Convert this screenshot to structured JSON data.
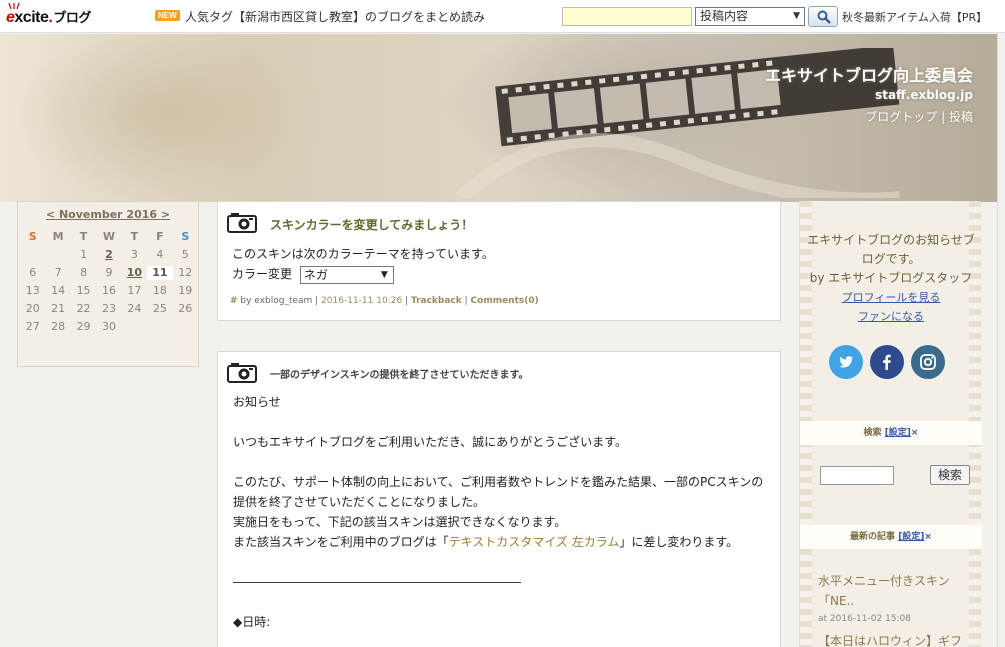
{
  "topbar": {
    "logo_e": "e",
    "logo_rest": "xcite",
    "logo_blog": "ブログ",
    "new_badge": "NEW",
    "tag_text": "人気タグ【新潟市西区貸し教室】のブログをまとめ読み",
    "search_value": "",
    "search_scope": "投稿内容",
    "pr_text": "秋冬最新アイテム入荷【PR】"
  },
  "header": {
    "title": "エキサイトブログ向上委員会",
    "domain": "staff.exblog.jp",
    "nav_top": "ブログトップ",
    "nav_sep": " | ",
    "nav_post": "投稿"
  },
  "calendar": {
    "title": "< November 2016 >",
    "dow": [
      "S",
      "M",
      "T",
      "W",
      "T",
      "F",
      "S"
    ],
    "days": [
      "",
      "",
      "1",
      "2",
      "3",
      "4",
      "5",
      "6",
      "7",
      "8",
      "9",
      "10",
      "11",
      "12",
      "13",
      "14",
      "15",
      "16",
      "17",
      "18",
      "19",
      "20",
      "21",
      "22",
      "23",
      "24",
      "25",
      "26",
      "27",
      "28",
      "29",
      "30",
      "",
      "",
      ""
    ],
    "linked_days": [
      "2",
      "10"
    ],
    "today": "11"
  },
  "post1": {
    "title": "スキンカラーを変更してみましょう！",
    "line1": "このスキンは次のカラーテーマを持っています。",
    "color_label": "カラー変更",
    "color_value": "ネガ",
    "meta_hash": "#",
    "meta_by": " by exblog_team | ",
    "meta_date": "2016-11-11 10:26",
    "meta_sep1": " | ",
    "meta_trackback": "Trackback",
    "meta_sep2": " | ",
    "meta_comments": "Comments(0)"
  },
  "post2": {
    "title": "一部のデザインスキンの提供を終了させていただきます。",
    "p1": "お知らせ",
    "p2": "いつもエキサイトブログをご利用いただき、誠にありがとうございます。",
    "p3a": "このたび、サポート体制の向上において、ご利用者数やトレンドを鑑みた結果、一部のPCスキンの",
    "p3b": "提供を終了させていただくことになりました。",
    "p3c": "実施日をもって、下記の該当スキンは選択できなくなります。",
    "p3d_pre": "また該当スキンをご利用中のブログは「",
    "p3d_link": "テキストカスタマイズ 左カラム",
    "p3d_post": "」に差し変わります。",
    "divider": "――――――――――――――――――――――――",
    "date_label": "◆日時:"
  },
  "sidebar": {
    "notice1": "エキサイトブログのお知らせブログです。",
    "notice2": "by エキサイトブログスタッフ",
    "profile_link": "プロフィールを見る",
    "fan_link": "ファンになる",
    "search_heading": "検索",
    "cfg": "[設定]",
    "x": "×",
    "search_button": "検索",
    "recent_heading": "最新の記事",
    "recent1_title": "水平メニュー付きスキン「NE..",
    "recent1_date": "at 2016-11-02 15:08",
    "recent2_title": "【本日はハロウィン】ギフト.."
  },
  "colors": {
    "accent": "#5c6b2a",
    "link": "#3358a8",
    "twitter": "#3fa3e6",
    "facebook": "#2d4a90",
    "instagram": "#3a6b8a"
  },
  "icons": [
    "search-icon",
    "camera-icon",
    "twitter-icon",
    "facebook-icon",
    "instagram-icon"
  ]
}
